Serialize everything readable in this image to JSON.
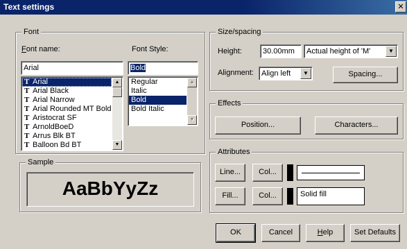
{
  "window": {
    "title": "Text settings",
    "close_glyph": "✕"
  },
  "font_group": {
    "label": "Font",
    "font_name_label": "Font name:",
    "font_name_value": "Arial",
    "font_list": [
      "Arial",
      "Arial Black",
      "Arial Narrow",
      "Arial Rounded MT Bold",
      "Aristocrat SF",
      "ArnoldBoeD",
      "Arrus Blk BT",
      "Balloon Bd BT"
    ],
    "font_list_selected": "Arial",
    "font_style_label": "Font Style:",
    "font_style_value": "Bold",
    "style_list": [
      "Regular",
      "Italic",
      "Bold",
      "Bold Italic"
    ],
    "style_list_selected": "Bold",
    "truetype_icon": "truetype-font-icon",
    "truetype_glyph": "T"
  },
  "sample_group": {
    "label": "Sample",
    "text": "AaBbYyZz"
  },
  "size_group": {
    "label": "Size/spacing",
    "height_label": "Height:",
    "height_value": "30.00mm",
    "height_mode": "Actual height of 'M'",
    "alignment_label": "Alignment:",
    "alignment_value": "Align left",
    "spacing_button": "Spacing..."
  },
  "effects_group": {
    "label": "Effects",
    "position_button": "Position...",
    "characters_button": "Characters..."
  },
  "attributes_group": {
    "label": "Attributes",
    "line_button": "Line...",
    "line_colour_button": "Col...",
    "line_colour": "#000000",
    "fill_button": "Fill...",
    "fill_colour_button": "Col...",
    "fill_colour": "#000000",
    "fill_value": "Solid fill"
  },
  "footer": {
    "ok": "OK",
    "cancel": "Cancel",
    "help": "Help",
    "set_defaults": "Set Defaults"
  },
  "glyphs": {
    "arrow_up": "▲",
    "arrow_down": "▼"
  }
}
